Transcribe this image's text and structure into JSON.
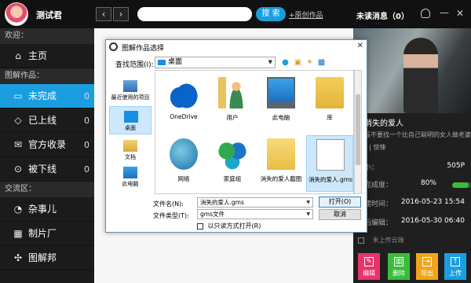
{
  "header": {
    "username": "测试君",
    "back_icon": "‹",
    "forward_icon": "›",
    "search_button": "搜 索",
    "publish_link": "+原创作品",
    "unread": "未读消息（0）",
    "minimize_icon": "—",
    "close_icon": "✕"
  },
  "sidebar": {
    "section_welcome": "欢迎：",
    "home": "主页",
    "section_works": "图解作品：",
    "items": [
      {
        "label": "未完成",
        "count": "0",
        "icon": "▭"
      },
      {
        "label": "已上线",
        "count": "0",
        "icon": "◇"
      },
      {
        "label": "官方收录",
        "count": "0",
        "icon": "✉"
      },
      {
        "label": "被下线",
        "count": "0",
        "icon": "⊙"
      }
    ],
    "section_exchange": "交流区：",
    "exchange": [
      {
        "label": "杂事儿",
        "icon": "◔"
      },
      {
        "label": "制片厂",
        "icon": "▦"
      },
      {
        "label": "图解邦",
        "icon": "✣"
      }
    ]
  },
  "right_panel": {
    "title": "消失的爱人",
    "desc": "看不要找一个比自己聪明的女人做老婆",
    "tags": "\"        | 惊悚",
    "size_label": "小：",
    "size_value": "505P",
    "progress_label": "完成度：",
    "progress_value": "80%",
    "progress_fraction": 0.8,
    "created_label": "建时间：",
    "created_value": "2016-05-23 15:54",
    "modified_label": "后编辑：",
    "modified_value": "2016-05-30 06:40",
    "cloud": "未上传云端",
    "actions": [
      {
        "label": "编辑",
        "color": "#e8336d",
        "icon": "✎"
      },
      {
        "label": "删除",
        "color": "#3cbc3c",
        "icon": "▥"
      },
      {
        "label": "导出",
        "color": "#f0a51c",
        "icon": "⇥"
      },
      {
        "label": "上传",
        "color": "#1a9ee0",
        "icon": "↑"
      }
    ]
  },
  "dialog": {
    "title": "图解作品选择",
    "close_icon": "✕",
    "lookin_label": "查找范围(I):",
    "lookin_value": "桌面",
    "places": [
      {
        "label": "最近使用的项目"
      },
      {
        "label": "桌面"
      },
      {
        "label": "文档"
      },
      {
        "label": "此电脑"
      }
    ],
    "files": [
      {
        "label": "OneDrive",
        "icon": "onedrive-icon"
      },
      {
        "label": "用户",
        "icon": "user-folder-icon"
      },
      {
        "label": "此电脑",
        "icon": "computer-icon"
      },
      {
        "label": "库",
        "icon": "library-icon"
      },
      {
        "label": "网络",
        "icon": "network-icon"
      },
      {
        "label": "家庭组",
        "icon": "homegroup-icon"
      },
      {
        "label": "消失的爱人截图",
        "icon": "folder-icon"
      },
      {
        "label": "消失的爱人.gms",
        "icon": "file-icon"
      }
    ],
    "filename_label": "文件名(N):",
    "filename_value": "消失的爱人.gms",
    "filetype_label": "文件类型(T):",
    "filetype_value": "gms文件",
    "readonly_label": "以只读方式打开(R)",
    "open_label": "打开(O)",
    "cancel_label": "取消"
  }
}
